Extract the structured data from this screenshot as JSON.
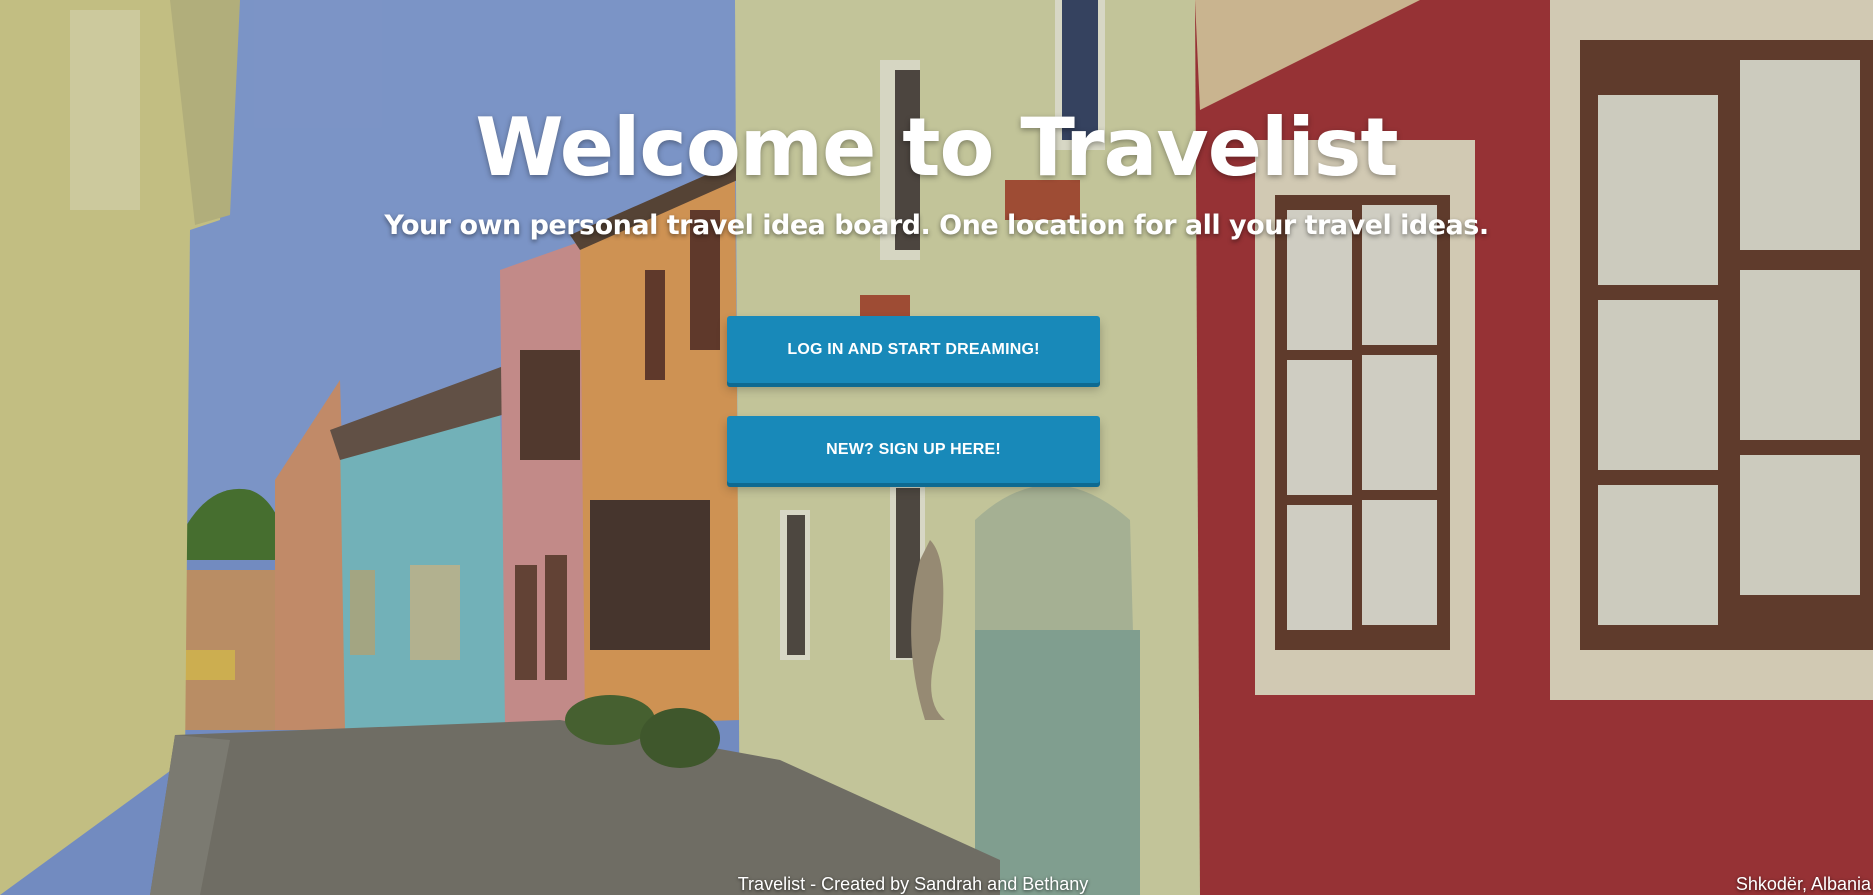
{
  "hero": {
    "title": "Welcome to Travelist",
    "subtitle": "Your own personal travel idea board. One location for all your travel ideas."
  },
  "buttons": {
    "login_label": "LOG IN AND START DREAMING!",
    "signup_label": "NEW? SIGN UP HERE!"
  },
  "footer": {
    "credit": "Travelist - Created by Sandrah and Bethany",
    "location": "Shkodër, Albania"
  },
  "colors": {
    "button": "#1889b9",
    "text": "#ffffff"
  }
}
